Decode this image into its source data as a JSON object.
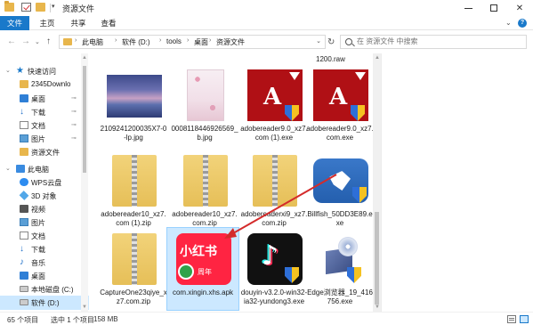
{
  "titlebar": {
    "title": "资源文件",
    "dropdown": "▾",
    "minimize": "",
    "maximize": "",
    "close": "✕"
  },
  "ribbon": {
    "tabs": [
      "文件",
      "主页",
      "共享",
      "查看"
    ],
    "expand": "⌄",
    "help": "?"
  },
  "address": {
    "back": "←",
    "forward": "→",
    "recent": "⌄",
    "up": "↑",
    "crumbs": [
      "此电脑",
      "软件 (D:)",
      "tools",
      "桌面",
      "资源文件"
    ],
    "separator": "›",
    "dropdown": "⌄",
    "refresh": "↻",
    "search_placeholder": "在 资源文件 中搜索"
  },
  "sidebar": {
    "items": [
      {
        "label": "快速访问",
        "icon": "star-icon",
        "pinned": false
      },
      {
        "label": "2345Downlo",
        "icon": "folder-icon",
        "pinned": true
      },
      {
        "label": "桌面",
        "icon": "desktop-icon",
        "pinned": true
      },
      {
        "label": "下载",
        "icon": "download-icon",
        "pinned": true
      },
      {
        "label": "文档",
        "icon": "document-icon",
        "pinned": true
      },
      {
        "label": "图片",
        "icon": "pictures-icon",
        "pinned": true
      },
      {
        "label": "资源文件",
        "icon": "folder-icon",
        "pinned": false
      },
      {
        "label": "此电脑",
        "icon": "pc-icon",
        "pinned": false
      },
      {
        "label": "WPS云盘",
        "icon": "cloud-icon",
        "pinned": false
      },
      {
        "label": "3D 对象",
        "icon": "3d-objects-icon",
        "pinned": false
      },
      {
        "label": "视频",
        "icon": "video-icon",
        "pinned": false
      },
      {
        "label": "图片",
        "icon": "pictures-icon",
        "pinned": false
      },
      {
        "label": "文档",
        "icon": "document-icon",
        "pinned": false
      },
      {
        "label": "下载",
        "icon": "download-icon",
        "pinned": false
      },
      {
        "label": "音乐",
        "icon": "music-icon",
        "pinned": false
      },
      {
        "label": "桌面",
        "icon": "desktop-icon",
        "pinned": false
      },
      {
        "label": "本地磁盘 (C:)",
        "icon": "drive-icon",
        "pinned": false
      },
      {
        "label": "软件 (D:)",
        "icon": "drive-icon",
        "pinned": false
      }
    ],
    "pin_glyph": "📌"
  },
  "main": {
    "partial_top_name": "1200.raw",
    "files": [
      {
        "name": "2109241200035X7-0-lp.jpg",
        "type": "image"
      },
      {
        "name": "0008118446926569_b.jpg",
        "type": "image"
      },
      {
        "name": "adobereader9.0_xz7.com (1).exe",
        "type": "pdf-installer"
      },
      {
        "name": "adobereader9.0_xz7.com.exe",
        "type": "pdf-installer"
      },
      {
        "name": "adobereader10_xz7.com (1).zip",
        "type": "zip"
      },
      {
        "name": "adobereader10_xz7.com.zip",
        "type": "zip"
      },
      {
        "name": "adobereaderxi9_xz7.com.zip",
        "type": "zip"
      },
      {
        "name": "Billfish_50DD3E89.exe",
        "type": "installer"
      },
      {
        "name": "CaptureOne23qiye_xz7.com.zip",
        "type": "zip"
      },
      {
        "name": "com.xingin.xhs.apk",
        "type": "apk",
        "selected": true
      },
      {
        "name": "douyin-v3.2.0-win32-ia32-yundong3.exe",
        "type": "installer"
      },
      {
        "name": "Edge浏览器_19_416756.exe",
        "type": "installer"
      }
    ],
    "xhs_icon_text": "小红书",
    "xhs_band_text": "周年",
    "pdf_symbol": "A",
    "douyin_symbol": "♪"
  },
  "status": {
    "count": "65 个项目",
    "selected": "选中 1 个项目",
    "size": "158 MB"
  },
  "colors": {
    "accent": "#1979ca",
    "selection": "#cce8ff",
    "arrow": "#d42b2b"
  }
}
